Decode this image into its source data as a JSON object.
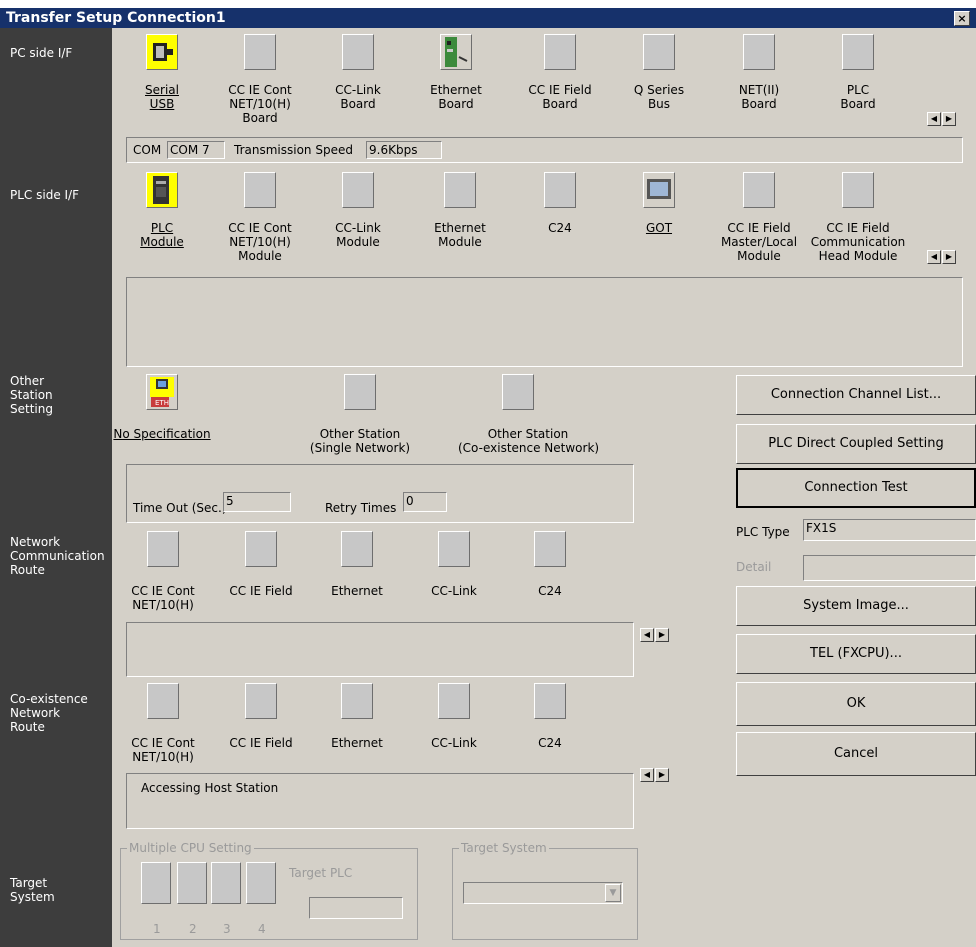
{
  "window": {
    "title": "Transfer Setup Connection1",
    "close": "×"
  },
  "sidebar": {
    "pc_side": "PC side I/F",
    "plc_side": "PLC side I/F",
    "other_station": "Other\nStation\nSetting",
    "network_route": "Network\nCommunication\nRoute",
    "coexist_route": "Co-existence\nNetwork\nRoute",
    "target_system": "Target\nSystem"
  },
  "pc_if": {
    "items": [
      "Serial\nUSB",
      "CC IE Cont\nNET/10(H)\nBoard",
      "CC-Link\nBoard",
      "Ethernet\nBoard",
      "CC IE Field\nBoard",
      "Q Series\nBus",
      "NET(II)\nBoard",
      "PLC\nBoard"
    ],
    "com_label": "COM",
    "com_value": "COM 7",
    "speed_label": "Transmission Speed",
    "speed_value": "9.6Kbps"
  },
  "plc_if": {
    "items": [
      "PLC\nModule",
      "CC IE Cont\nNET/10(H)\nModule",
      "CC-Link\nModule",
      "Ethernet\nModule",
      "C24",
      "GOT",
      "CC IE Field\nMaster/Local\nModule",
      "CC IE Field\nCommunication\nHead Module"
    ]
  },
  "other_station": {
    "items": [
      "No Specification",
      "Other Station\n(Single Network)",
      "Other Station\n(Co-existence Network)"
    ],
    "timeout_label": "Time Out (Sec.)",
    "timeout_value": "5",
    "retry_label": "Retry Times",
    "retry_value": "0"
  },
  "network_route": {
    "items": [
      "CC IE Cont\nNET/10(H)",
      "CC IE Field",
      "Ethernet",
      "CC-Link",
      "C24"
    ]
  },
  "coexist_route": {
    "items": [
      "CC IE Cont\nNET/10(H)",
      "CC IE Field",
      "Ethernet",
      "CC-Link",
      "C24"
    ],
    "info": "Accessing Host Station"
  },
  "target": {
    "multi_cpu_caption": "Multiple CPU Setting",
    "cpu_numbers": [
      "1",
      "2",
      "3",
      "4"
    ],
    "target_plc_label": "Target PLC",
    "target_system_caption": "Target System"
  },
  "buttons": {
    "channel_list": "Connection Channel List...",
    "direct_coupled": "PLC Direct Coupled Setting",
    "connection_test": "Connection Test",
    "plc_type_label": "PLC Type",
    "plc_type_value": "FX1S",
    "detail_label": "Detail",
    "system_image": "System Image...",
    "tel": "TEL (FXCPU)...",
    "ok": "OK",
    "cancel": "Cancel"
  },
  "colors": {
    "title_bar": "#16316b",
    "sidebar": "#3d3d3d",
    "dialog": "#d4d0c8",
    "selected_icon": "#ffff00"
  }
}
